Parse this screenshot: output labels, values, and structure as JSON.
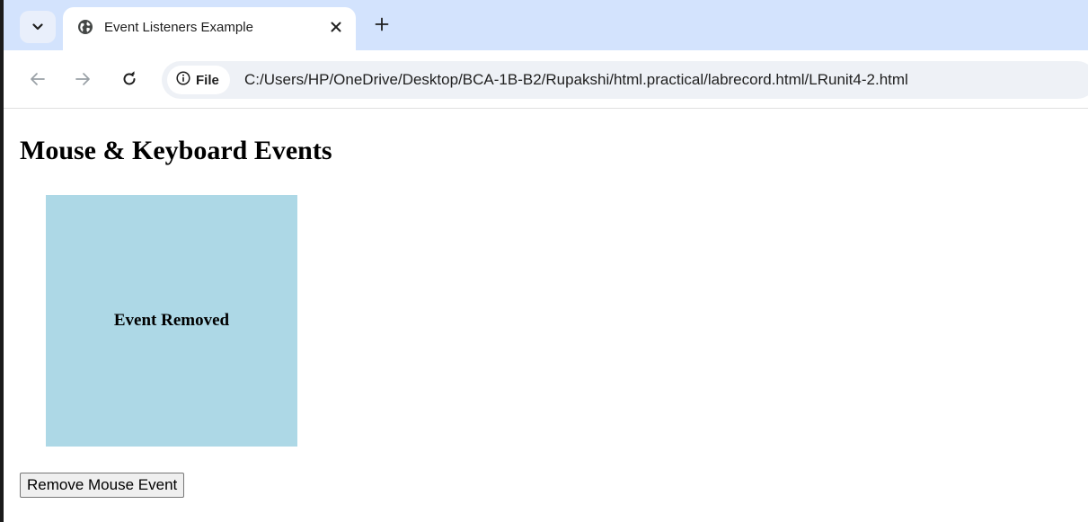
{
  "browser": {
    "tab": {
      "title": "Event Listeners Example",
      "favicon": "globe-icon",
      "close_icon": "close-icon"
    },
    "new_tab_icon": "plus-icon",
    "tab_search_icon": "chevron-down-icon",
    "nav": {
      "back_icon": "back-arrow-icon",
      "forward_icon": "forward-arrow-icon",
      "reload_icon": "reload-icon"
    },
    "address_bar": {
      "scheme_chip_label": "File",
      "scheme_chip_icon": "info-icon",
      "url": "C:/Users/HP/OneDrive/Desktop/BCA-1B-B2/Rupakshi/html.practical/labrecord.html/LRunit4-2.html"
    },
    "colors": {
      "tabstrip": "#d3e3fd",
      "omnibox": "#eef1f6"
    }
  },
  "page": {
    "heading": "Mouse & Keyboard Events",
    "box": {
      "text": "Event Removed",
      "color": "#add8e6"
    },
    "button_label": "Remove Mouse Event"
  }
}
